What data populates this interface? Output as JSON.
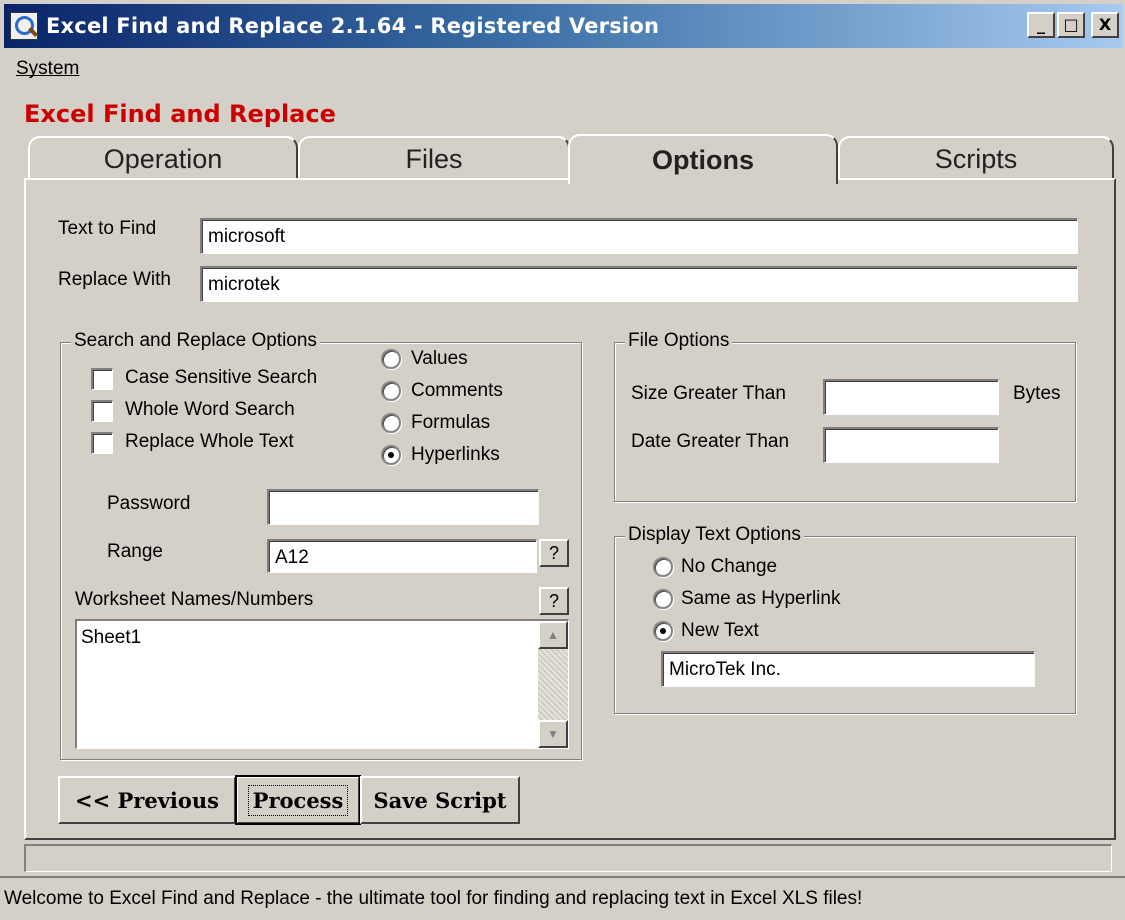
{
  "window": {
    "title": "Excel Find and Replace 2.1.64 - Registered Version",
    "minimize": "_",
    "maximize": "□",
    "close": "X"
  },
  "menu": {
    "system": "System"
  },
  "app_heading": "Excel Find and Replace",
  "tabs": [
    {
      "label": "Operation",
      "active": false
    },
    {
      "label": "Files",
      "active": false
    },
    {
      "label": "Options",
      "active": true
    },
    {
      "label": "Scripts",
      "active": false
    }
  ],
  "find": {
    "label": "Text to Find",
    "value": "microsoft"
  },
  "replace": {
    "label": "Replace With",
    "value": "microtek"
  },
  "search_options": {
    "title": "Search and Replace Options",
    "checkboxes": [
      {
        "label": "Case Sensitive Search",
        "checked": false
      },
      {
        "label": "Whole Word Search",
        "checked": false
      },
      {
        "label": "Replace Whole Text",
        "checked": false
      }
    ],
    "radios": [
      {
        "label": "Values",
        "checked": false
      },
      {
        "label": "Comments",
        "checked": false
      },
      {
        "label": "Formulas",
        "checked": false
      },
      {
        "label": "Hyperlinks",
        "checked": true
      }
    ],
    "password_label": "Password",
    "password_value": "",
    "range_label": "Range",
    "range_value": "A12",
    "help": "?",
    "worksheet_label": "Worksheet Names/Numbers",
    "worksheet_items": [
      "Sheet1"
    ],
    "scroll_up": "▲",
    "scroll_down": "▼"
  },
  "file_options": {
    "title": "File Options",
    "size_label": "Size Greater Than",
    "size_value": "",
    "size_unit": "Bytes",
    "date_label": "Date Greater Than",
    "date_value": ""
  },
  "display_options": {
    "title": "Display Text Options",
    "radios": [
      {
        "label": "No Change",
        "checked": false
      },
      {
        "label": "Same as Hyperlink",
        "checked": false
      },
      {
        "label": "New Text",
        "checked": true
      }
    ],
    "new_text_value": "MicroTek Inc."
  },
  "buttons": {
    "previous": "<< Previous",
    "process": "Process",
    "save_script": "Save Script"
  },
  "status": "Welcome to Excel Find and Replace - the ultimate tool for finding and replacing text in Excel XLS files!"
}
